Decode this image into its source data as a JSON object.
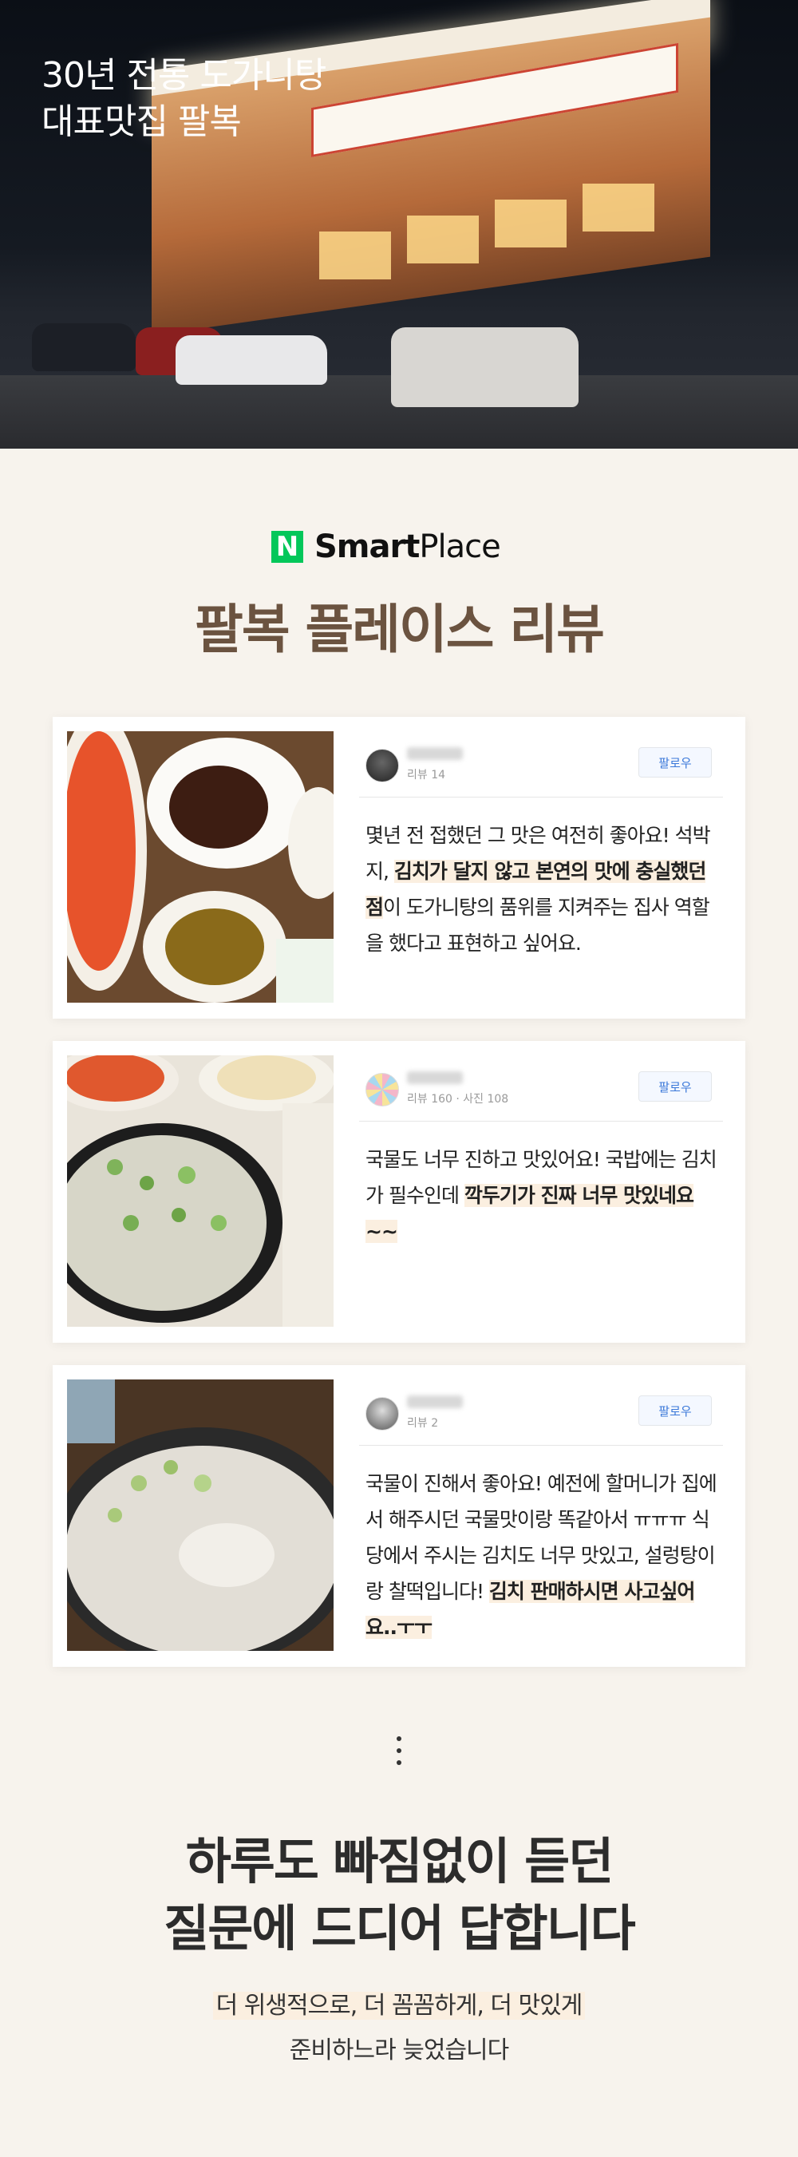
{
  "hero": {
    "title_line1": "30년 전통 도가니탕",
    "title_line2": "대표맛집 팔복"
  },
  "brand": {
    "n_mark": "N",
    "name_bold": "Smart",
    "name_regular": "Place",
    "accent": "#03c75a"
  },
  "section_title": "팔복 플레이스 리뷰",
  "follow_label": "팔로우",
  "reviews": [
    {
      "stats": "리뷰 14",
      "text_plain_1": "몇년 전 접했던 그 맛은 여전히 좋아요! 석박지, ",
      "text_highlight": "김치가 달지 않고 본연의 맛에 충실했던 점",
      "text_plain_2": "이 도가니탕의 품위를 지켜주는 집사 역할을 했다고 표현하고 싶어요."
    },
    {
      "stats": "리뷰 160 · 사진 108",
      "text_plain_1": "국물도 너무 진하고 맛있어요! 국밥에는 김치가 필수인데 ",
      "text_highlight": "깍두기가 진짜 너무 맛있네요~~",
      "text_plain_2": ""
    },
    {
      "stats": "리뷰 2",
      "text_plain_1": "국물이 진해서 좋아요! 예전에 할머니가 집에서 해주시던 국물맛이랑 똑같아서 ㅠㅠㅠ 식당에서 주시는 김치도 너무 맛있고, 설렁탕이랑 찰떡입니다! ",
      "text_highlight": "김치 판매하시면 사고싶어요..ㅜㅜ",
      "text_plain_2": ""
    }
  ],
  "closing": {
    "line1": "하루도 빠짐없이 듣던",
    "line2": "질문에 드디어 답합니다"
  },
  "sub": {
    "line1": "더 위생적으로, 더 꼼꼼하게, 더 맛있게",
    "line2": "준비하느라 늦었습니다"
  }
}
